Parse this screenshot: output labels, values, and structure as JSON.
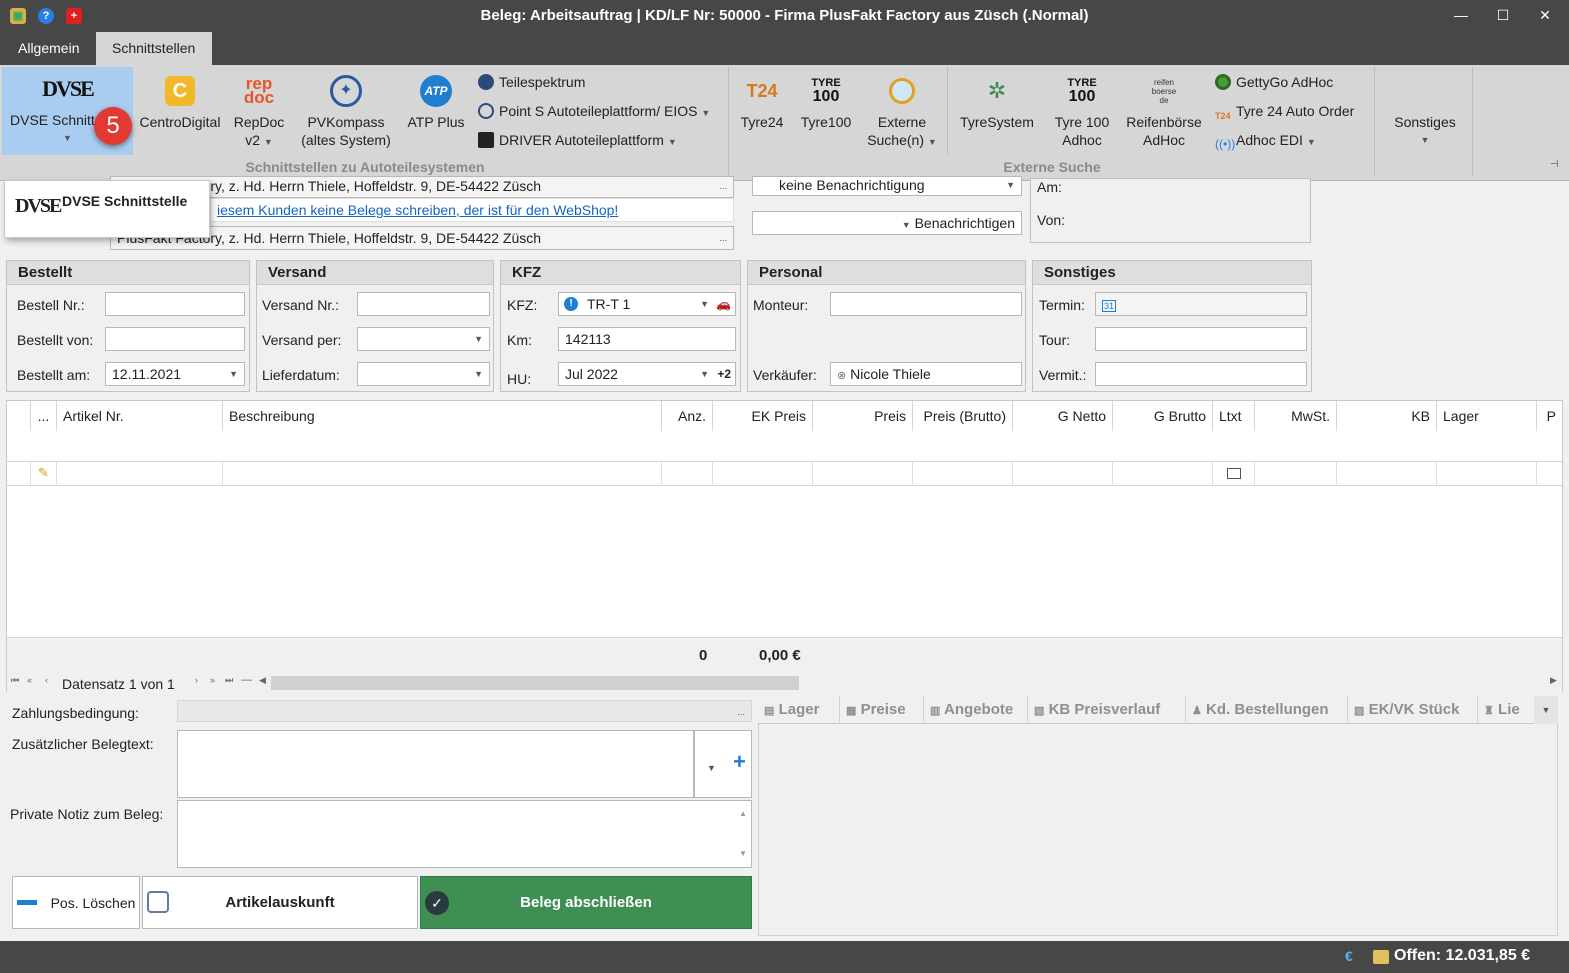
{
  "window": {
    "title": "Beleg: Arbeitsauftrag |  KD/LF Nr: 50000 - Firma PlusFakt Factory  aus Züsch (.Normal)"
  },
  "tabs": [
    "Allgemein",
    "Schnittstellen"
  ],
  "ribbon": {
    "dvse": "DVSE Schnitt",
    "centro": "CentroDigital",
    "repdoc_1": "RepDoc",
    "repdoc_2": "v2",
    "pvk_1": "PVKompass",
    "pvk_2": "(altes System)",
    "atp": "ATP Plus",
    "teilespektrum": "Teilespektrum",
    "points": "Point S Autoteileplattform/ EIOS",
    "driver": "DRIVER Autoteileplattform",
    "group1": "Schnittstellen zu Autoteilesystemen",
    "tyre24": "Tyre24",
    "tyre100": "Tyre100",
    "ext_1": "Externe",
    "ext_2": "Suche(n)",
    "tyresystem": "TyreSystem",
    "t100a_1": "Tyre 100",
    "t100a_2": "Adhoc",
    "rb_1": "Reifenbörse",
    "rb_2": "AdHoc",
    "gettygo": "GettyGo AdHoc",
    "t24order": "Tyre 24 Auto Order",
    "adhocedi": "Adhoc EDI",
    "group2": "Externe Suche",
    "sonstiges": "Sonstiges",
    "logo_dvse": "DVSE",
    "logo_repdoc_1": "rep",
    "logo_repdoc_2": "doc",
    "logo_atp": "ATP",
    "logo_t24": "T24",
    "logo_tyre": "TYRE",
    "logo_100": "100",
    "logo_rb_1": "reifen",
    "logo_rb_2": "boerse",
    "logo_rb_3": "de"
  },
  "step_badge": "5",
  "dropdown": {
    "item": "DVSE Schnittstelle"
  },
  "header_fields": {
    "addr1": "PlusFakt Factory, z. Hd. Herrn Thiele, Hoffeldstr. 9, DE-54422 Züsch",
    "warning": "iesem Kunden keine Belege schreiben, der ist für den WebShop!",
    "addr2": "PlusFakt Factory, z. Hd. Herrn Thiele, Hoffeldstr. 9, DE-54422 Züsch",
    "notify_value": "keine Benachrichtigung",
    "notify_btn": "Benachrichtigen",
    "am": "Am:",
    "von": "Von:"
  },
  "bestellt": {
    "title": "Bestellt",
    "nr": "Bestell Nr.:",
    "von": "Bestellt von:",
    "am": "Bestellt am:",
    "am_value": "12.11.2021"
  },
  "versand": {
    "title": "Versand",
    "nr": "Versand Nr.:",
    "per": "Versand per:",
    "lieferdatum": "Lieferdatum:"
  },
  "kfz": {
    "title": "KFZ",
    "kfz": "KFZ:",
    "kfz_value": "TR-T 1",
    "km": "Km:",
    "km_value": "142113",
    "hu": "HU:",
    "hu_value": "Jul 2022",
    "hu_extra": "+2"
  },
  "personal": {
    "title": "Personal",
    "monteur": "Monteur:",
    "verkaeufer": "Verkäufer:",
    "verkaeufer_value": "Nicole Thiele"
  },
  "sonstiges": {
    "title": "Sonstiges",
    "termin": "Termin:",
    "tour": "Tour:",
    "vermit": "Vermit.:",
    "calendar_day": "31"
  },
  "grid": {
    "columns": [
      "...",
      "Artikel Nr.",
      "Beschreibung",
      "Anz.",
      "EK Preis",
      "Preis",
      "Preis (Brutto)",
      "G Netto",
      "G Brutto",
      "Ltxt",
      "MwSt.",
      "KB",
      "Lager",
      "P"
    ],
    "total_qty": "0",
    "total_sum": "0,00 €",
    "nav_text": "Datensatz 1 von 1"
  },
  "bottom": {
    "zahlung": "Zahlungsbedingung:",
    "zusatz": "Zusätzlicher Belegtext:",
    "notiz": "Private Notiz zum Beleg:",
    "pos_loeschen": "Pos. Löschen",
    "artikelauskunft": "Artikelauskunft",
    "abschliessen": "Beleg abschließen",
    "ellipsis": "..."
  },
  "right_tabs": [
    "Lager",
    "Preise",
    "Angebote",
    "KB Preisverlauf",
    "Kd. Bestellungen",
    "EK/VK Stück",
    "Lie"
  ],
  "status": {
    "offen": "Offen: 12.031,85 €",
    "euro": "€"
  },
  "colors": {
    "titlebar": "#474747",
    "ribbon": "#d6d6d6",
    "selected": "#a9cdf0",
    "badge": "#e23a32",
    "accept": "#3f8f55",
    "link": "#1565c0"
  }
}
